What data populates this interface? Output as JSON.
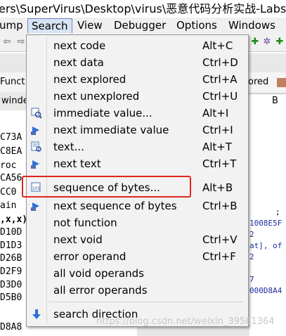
{
  "window": {
    "title": "ers\\SuperVirus\\Desktop\\virus\\恶意代码分析实战-Labs\\Prac"
  },
  "menubar": {
    "items": [
      "ump",
      "Search",
      "View",
      "Debugger",
      "Options",
      "Windows"
    ]
  },
  "background": {
    "funct_label": "Funct",
    "winde_label": "winde",
    "ored_label": "ored",
    "right_b_label": "B",
    "left_lines": [
      "C73A",
      "C8EA",
      "roc",
      "CA56",
      "CC0",
      "ain",
      ",x,x)",
      "D10D",
      "D1D3",
      "D26B",
      "D2F9",
      "D3D0",
      "D5B0",
      "",
      "D8A8"
    ],
    "right_lines": [
      ";",
      "1008E5F",
      "2",
      "at], of",
      "2",
      "",
      "7",
      "000D8A4"
    ]
  },
  "search_menu": {
    "items": [
      {
        "label": "next code",
        "shortcut": "Alt+C",
        "icon": ""
      },
      {
        "label": "next data",
        "shortcut": "Ctrl+D",
        "icon": ""
      },
      {
        "label": "next explored",
        "shortcut": "Ctrl+A",
        "icon": ""
      },
      {
        "label": "next unexplored",
        "shortcut": "Ctrl+U",
        "icon": ""
      },
      {
        "label": "immediate value...",
        "shortcut": "Alt+I",
        "icon": "search-immediate-icon"
      },
      {
        "label": "next immediate value",
        "shortcut": "Ctrl+I",
        "icon": "next-arrow-icon"
      },
      {
        "label": "text...",
        "shortcut": "Alt+T",
        "icon": "search-text-icon"
      },
      {
        "label": "next text",
        "shortcut": "Ctrl+T",
        "icon": "next-arrow-icon"
      },
      {
        "label": "sequence of bytes...",
        "shortcut": "Alt+B",
        "icon": "search-bytes-icon"
      },
      {
        "label": "next sequence of bytes",
        "shortcut": "Ctrl+B",
        "icon": "next-arrow-icon"
      },
      {
        "label": "not function",
        "shortcut": "",
        "icon": ""
      },
      {
        "label": "next void",
        "shortcut": "Ctrl+V",
        "icon": ""
      },
      {
        "label": "error operand",
        "shortcut": "Ctrl+F",
        "icon": ""
      },
      {
        "label": "all void operands",
        "shortcut": "",
        "icon": ""
      },
      {
        "label": "all error operands",
        "shortcut": "",
        "icon": ""
      }
    ],
    "direction": {
      "label": "search direction",
      "icon": "down-arrow-icon"
    }
  },
  "watermark": "https://blog.csdn.net/weixin_39561364",
  "colors": {
    "highlight": "#e0251b",
    "menu_bg": "#f2f2f2",
    "active_menu": "#d7e4f6"
  }
}
